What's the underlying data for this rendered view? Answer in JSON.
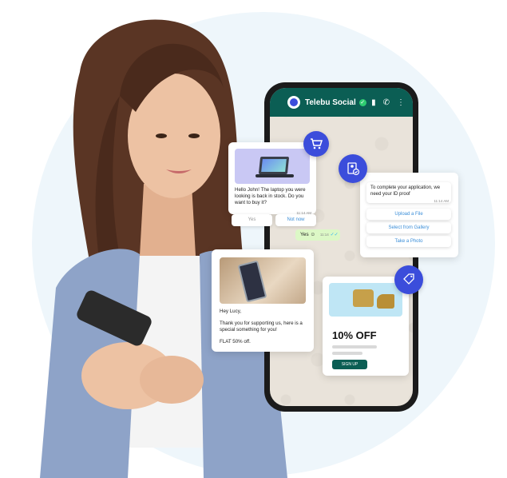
{
  "app": {
    "name": "Telebu Social"
  },
  "chat": {
    "laptop_message": "Hello John! The laptop you were looking is back in stock. Do you want to buy it?",
    "laptop_time": "11:14 AM",
    "quick_replies": [
      "Yes",
      "Not now"
    ],
    "reply_yes": "Yes",
    "reply_time": "11:14",
    "id_message": "To complete your application, we need your ID proof",
    "id_time": "11:14 AM",
    "id_options": [
      "Upload a File",
      "Select from Gallery",
      "Take a Photo"
    ],
    "promo_greeting": "Hey Lucy,",
    "promo_body": "Thank you for supporting us, here is a special something for you!",
    "promo_offer": "FLAT 50% off.",
    "discount_title": "10% OFF",
    "signup_label": "SIGN UP"
  },
  "colors": {
    "header": "#0b5e54",
    "badge": "#3b4ddb",
    "link": "#3b8ed8",
    "reply_bubble": "#dcf8c6"
  }
}
